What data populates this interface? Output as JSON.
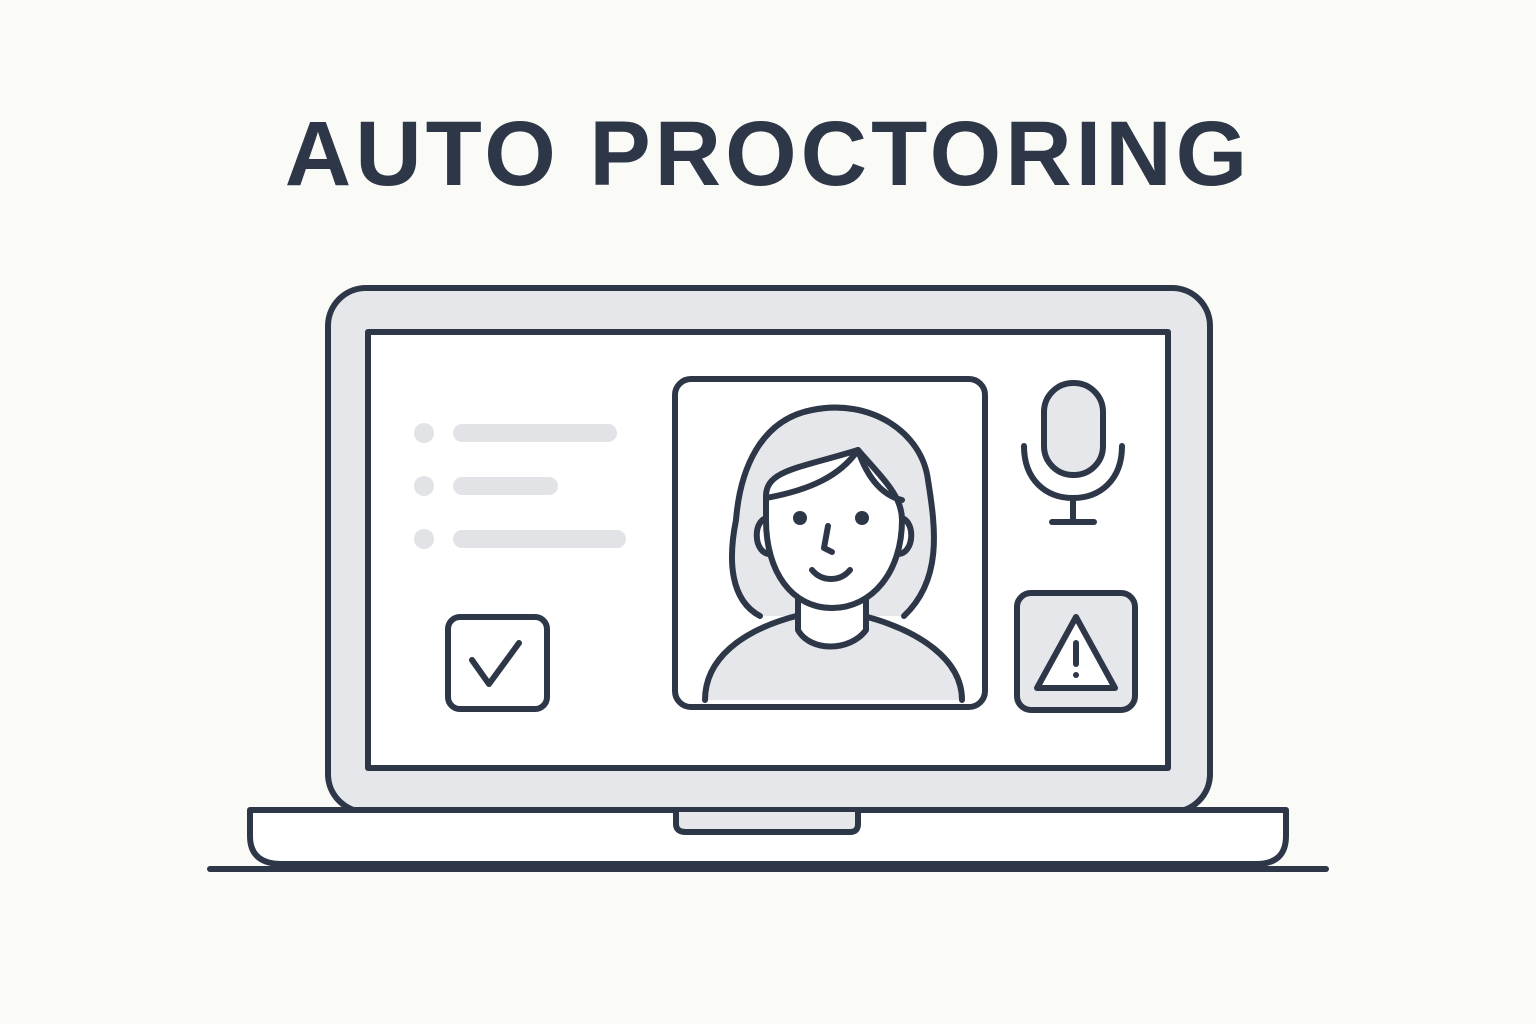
{
  "title": "AUTO PROCTORING",
  "colors": {
    "background": "#fafaf7",
    "stroke": "#2d3748",
    "fill_light": "#e6e7ea",
    "screen": "#ffffff",
    "placeholder": "#e2e3e6"
  },
  "icons": {
    "check": "check-icon",
    "camera_person": "person-icon",
    "microphone": "microphone-icon",
    "warning": "warning-icon"
  },
  "checklist": {
    "lines": 3
  }
}
